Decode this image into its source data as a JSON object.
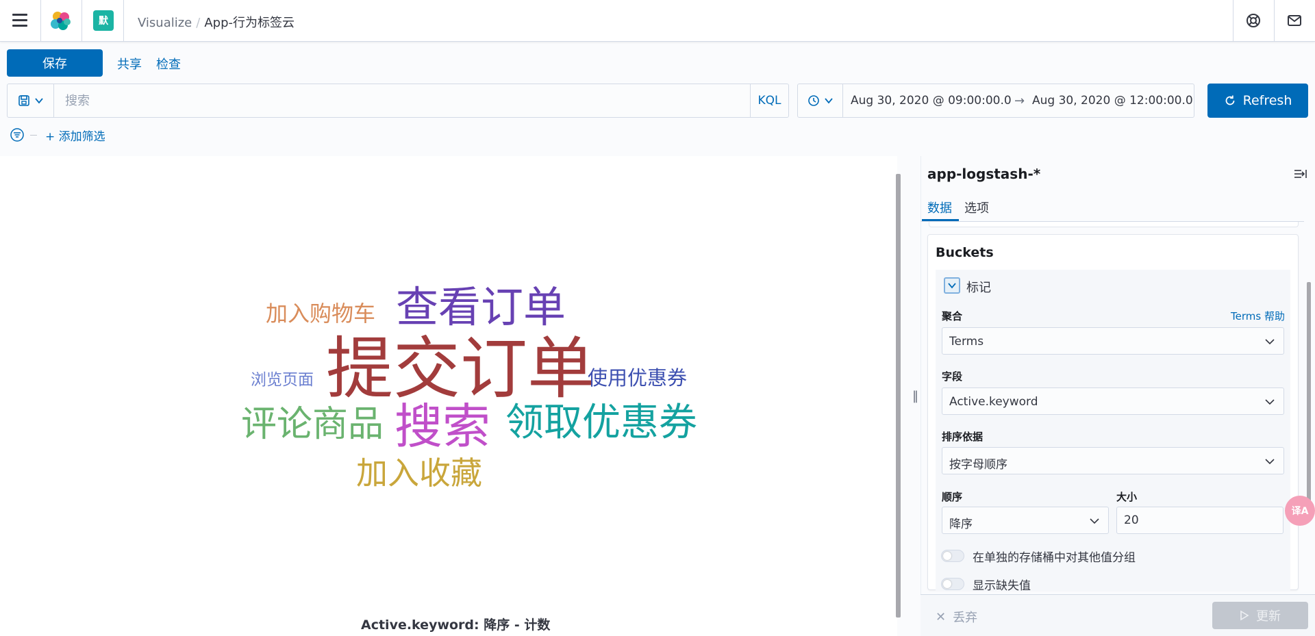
{
  "header": {
    "space_badge": "默",
    "breadcrumb": [
      "Visualize",
      "App-行为标签云"
    ]
  },
  "toolbar": {
    "save_label": "保存",
    "share_label": "共享",
    "inspect_label": "检查"
  },
  "query_bar": {
    "placeholder": "搜索",
    "language": "KQL"
  },
  "time_picker": {
    "start": "Aug 30, 2020 @ 09:00:00.0",
    "end": "Aug 30, 2020 @ 12:00:00.0",
    "arrow": "→"
  },
  "refresh_label": "Refresh",
  "filter": {
    "add_label": "+ 添加筛选"
  },
  "wordcloud": {
    "words": [
      {
        "text": "提交订单",
        "color": "#a23c3c"
      },
      {
        "text": "查看订单",
        "color": "#6741b3"
      },
      {
        "text": "搜索",
        "color": "#c04fc9"
      },
      {
        "text": "领取优惠券",
        "color": "#14a2a0"
      },
      {
        "text": "评论商品",
        "color": "#6ab36f"
      },
      {
        "text": "加入收藏",
        "color": "#c9a63b"
      },
      {
        "text": "加入购物车",
        "color": "#d98c5a"
      },
      {
        "text": "使用优惠券",
        "color": "#3c4fb0"
      },
      {
        "text": "浏览页面",
        "color": "#6b7fd0"
      }
    ],
    "caption": "Active.keyword: 降序 - 计数"
  },
  "sidebar": {
    "index_pattern": "app-logstash-*",
    "tabs": [
      "数据",
      "选项"
    ],
    "buckets_title": "Buckets",
    "agg_label": "标记",
    "aggregation_label": "聚合",
    "aggregation_help": "Terms 帮助",
    "aggregation_value": "Terms",
    "field_label": "字段",
    "field_value": "Active.keyword",
    "order_by_label": "排序依据",
    "order_by_value": "按字母顺序",
    "order_label": "顺序",
    "order_value": "降序",
    "size_label": "大小",
    "size_value": "20",
    "group_other_label": "在单独的存储桶中对其他值分组",
    "show_missing_label": "显示缺失值",
    "discard_label": "丢弃",
    "update_label": "更新"
  },
  "colors": {
    "primary": "#006bb8",
    "badge": "#1bb4a4"
  }
}
